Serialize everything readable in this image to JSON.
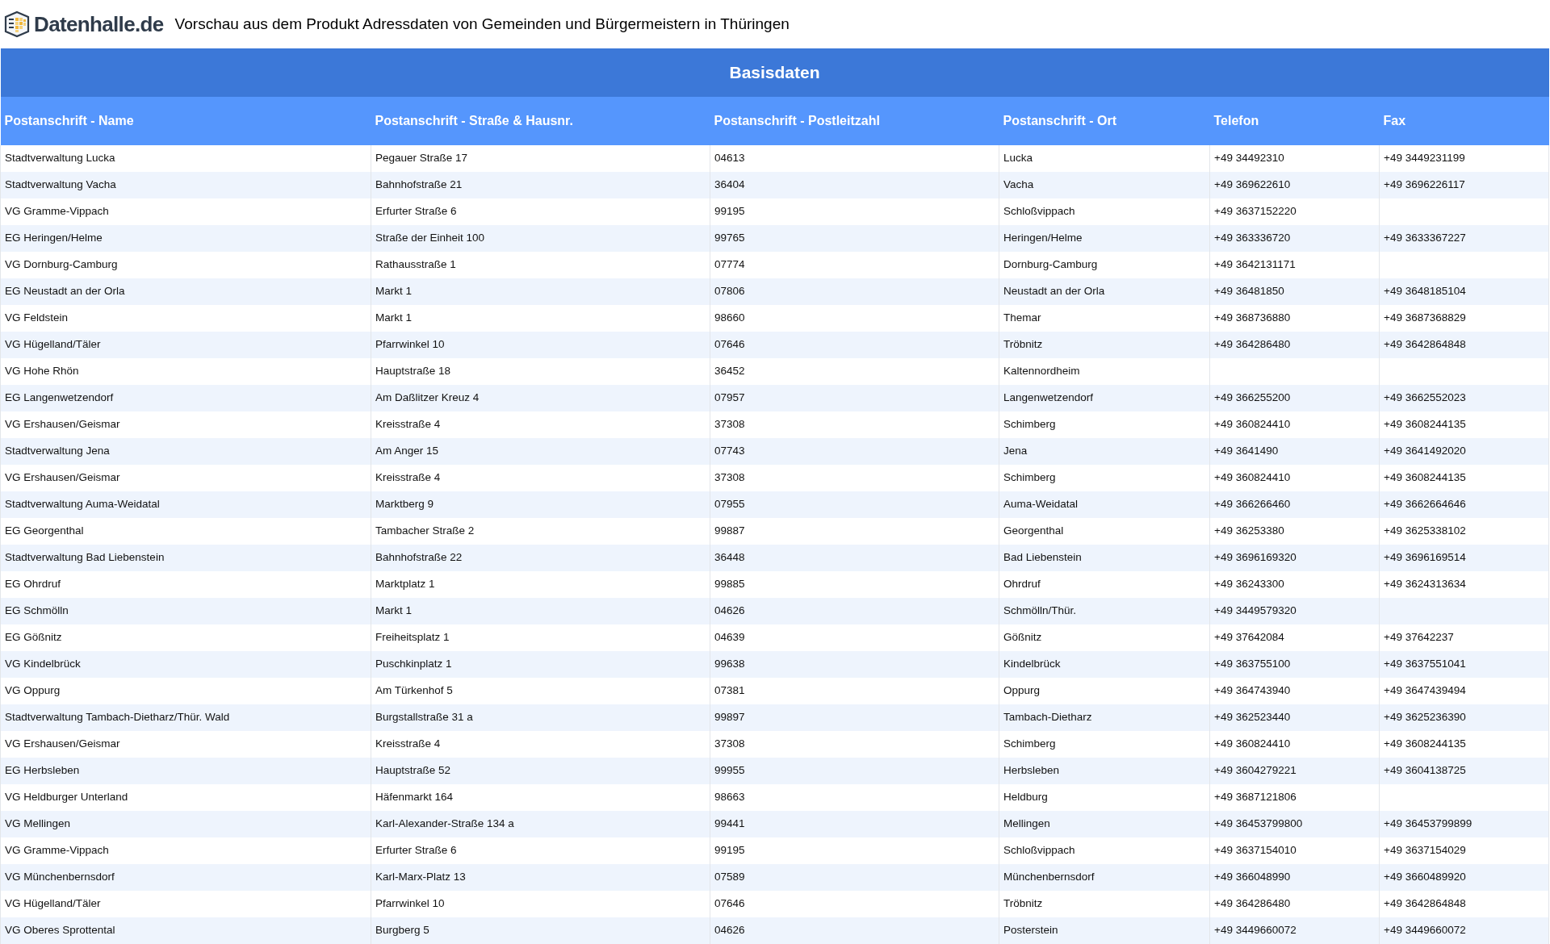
{
  "header": {
    "logo_text": "Datenhalle.de",
    "title": "Vorschau aus dem Produkt Adressdaten von Gemeinden und Bürgermeistern in Thüringen"
  },
  "table": {
    "group_heading": "Basisdaten",
    "columns": [
      "Postanschrift - Name",
      "Postanschrift - Straße & Hausnr.",
      "Postanschrift - Postleitzahl",
      "Postanschrift - Ort",
      "Telefon",
      "Fax"
    ],
    "rows": [
      [
        "Stadtverwaltung Lucka",
        "Pegauer Straße 17",
        "04613",
        "Lucka",
        "+49 34492310",
        "+49 3449231199"
      ],
      [
        "Stadtverwaltung Vacha",
        "Bahnhofstraße 21",
        "36404",
        "Vacha",
        "+49 369622610",
        "+49 3696226117"
      ],
      [
        "VG Gramme-Vippach",
        "Erfurter Straße 6",
        "99195",
        "Schloßvippach",
        "+49 3637152220",
        null
      ],
      [
        "EG Heringen/Helme",
        "Straße der Einheit 100",
        "99765",
        "Heringen/Helme",
        "+49 363336720",
        "+49 3633367227"
      ],
      [
        "VG Dornburg-Camburg",
        "Rathausstraße 1",
        "07774",
        "Dornburg-Camburg",
        "+49 3642131171",
        null
      ],
      [
        "EG Neustadt an der Orla",
        "Markt 1",
        "07806",
        "Neustadt an der Orla",
        "+49 36481850",
        "+49 3648185104"
      ],
      [
        "VG Feldstein",
        "Markt 1",
        "98660",
        "Themar",
        "+49 368736880",
        "+49 3687368829"
      ],
      [
        "VG Hügelland/Täler",
        "Pfarrwinkel 10",
        "07646",
        "Tröbnitz",
        "+49 364286480",
        "+49 3642864848"
      ],
      [
        "VG Hohe Rhön",
        "Hauptstraße 18",
        "36452",
        "Kaltennordheim",
        null,
        null
      ],
      [
        "EG Langenwetzendorf",
        "Am Daßlitzer Kreuz 4",
        "07957",
        "Langenwetzendorf",
        "+49 366255200",
        "+49 3662552023"
      ],
      [
        "VG Ershausen/Geismar",
        "Kreisstraße 4",
        "37308",
        "Schimberg",
        "+49 360824410",
        "+49 3608244135"
      ],
      [
        "Stadtverwaltung Jena",
        "Am Anger 15",
        "07743",
        "Jena",
        "+49 3641490",
        "+49 3641492020"
      ],
      [
        "VG Ershausen/Geismar",
        "Kreisstraße 4",
        "37308",
        "Schimberg",
        "+49 360824410",
        "+49 3608244135"
      ],
      [
        "Stadtverwaltung Auma-Weidatal",
        "Marktberg 9",
        "07955",
        "Auma-Weidatal",
        "+49 366266460",
        "+49 3662664646"
      ],
      [
        "EG Georgenthal",
        "Tambacher Straße 2",
        "99887",
        "Georgenthal",
        "+49 36253380",
        "+49 3625338102"
      ],
      [
        "Stadtverwaltung Bad Liebenstein",
        "Bahnhofstraße 22",
        "36448",
        "Bad Liebenstein",
        "+49 3696169320",
        "+49 3696169514"
      ],
      [
        "EG Ohrdruf",
        "Marktplatz 1",
        "99885",
        "Ohrdruf",
        "+49 36243300",
        "+49 3624313634"
      ],
      [
        "EG Schmölln",
        "Markt 1",
        "04626",
        "Schmölln/Thür.",
        "+49 3449579320",
        null
      ],
      [
        "EG Gößnitz",
        "Freiheitsplatz 1",
        "04639",
        "Gößnitz",
        "+49 37642084",
        "+49 37642237"
      ],
      [
        "VG Kindelbrück",
        "Puschkinplatz 1",
        "99638",
        "Kindelbrück",
        "+49 363755100",
        "+49 3637551041"
      ],
      [
        "VG Oppurg",
        "Am Türkenhof 5",
        "07381",
        "Oppurg",
        "+49 364743940",
        "+49 3647439494"
      ],
      [
        "Stadtverwaltung Tambach-Dietharz/Thür. Wald",
        "Burgstallstraße 31 a",
        "99897",
        "Tambach-Dietharz",
        "+49 362523440",
        "+49 3625236390"
      ],
      [
        "VG Ershausen/Geismar",
        "Kreisstraße 4",
        "37308",
        "Schimberg",
        "+49 360824410",
        "+49 3608244135"
      ],
      [
        "EG Herbsleben",
        "Hauptstraße 52",
        "99955",
        "Herbsleben",
        "+49 3604279221",
        "+49 3604138725"
      ],
      [
        "VG Heldburger Unterland",
        "Häfenmarkt 164",
        "98663",
        "Heldburg",
        "+49 3687121806",
        null
      ],
      [
        "VG Mellingen",
        "Karl-Alexander-Straße 134 a",
        "99441",
        "Mellingen",
        "+49 36453799800",
        "+49 36453799899"
      ],
      [
        "VG Gramme-Vippach",
        "Erfurter Straße 6",
        "99195",
        "Schloßvippach",
        "+49 3637154010",
        "+49 3637154029"
      ],
      [
        "VG Münchenbernsdorf",
        "Karl-Marx-Platz 13",
        "07589",
        "Münchenbernsdorf",
        "+49 366048990",
        "+49 3660489920"
      ],
      [
        "VG Hügelland/Täler",
        "Pfarrwinkel 10",
        "07646",
        "Tröbnitz",
        "+49 364286480",
        "+49 3642864848"
      ],
      [
        "VG Oberes Sprottental",
        "Burgberg 5",
        "04626",
        "Posterstein",
        "+49 3449660072",
        "+49 3449660072"
      ]
    ]
  }
}
